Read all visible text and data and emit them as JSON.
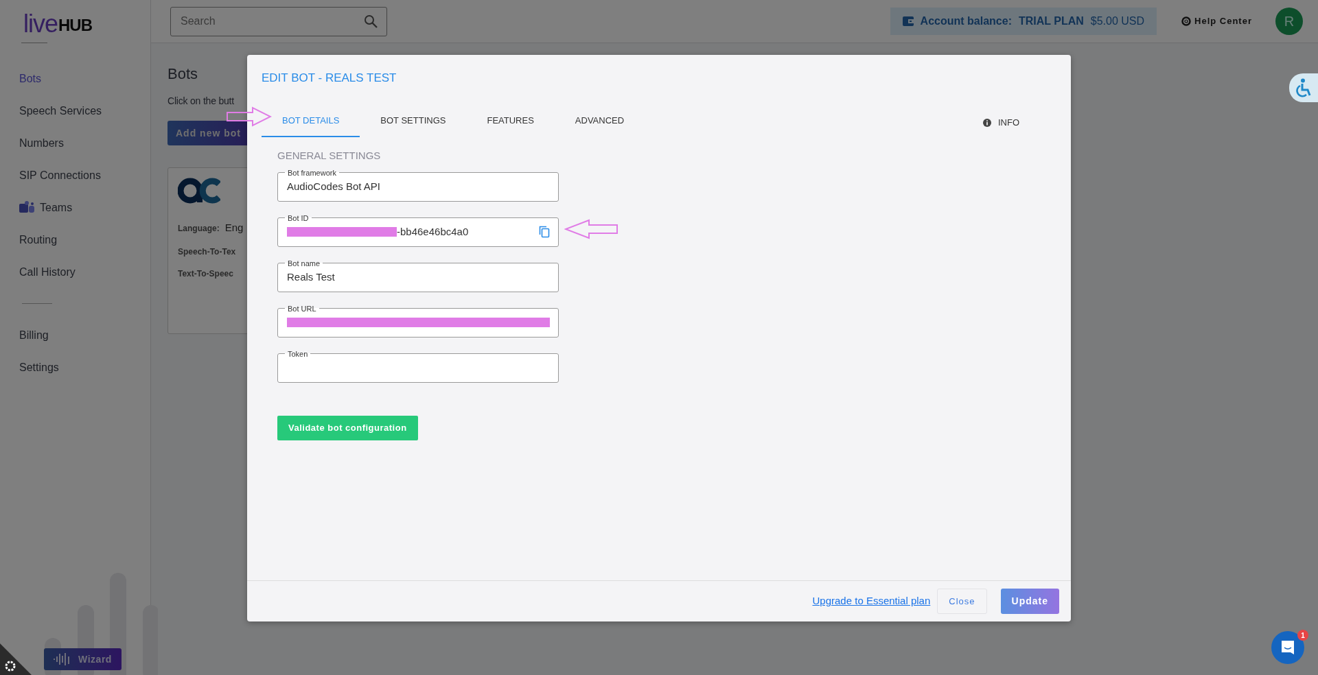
{
  "logo": {
    "part_1": "live",
    "part_2": "HUB"
  },
  "sidebar": {
    "groups": [
      {
        "items": [
          {
            "label": "Bots",
            "selected": true,
            "kind": "plain"
          },
          {
            "label": "Speech Services",
            "selected": false,
            "kind": "plain"
          },
          {
            "label": "Numbers",
            "selected": false,
            "kind": "plain"
          },
          {
            "label": "SIP Connections",
            "selected": false,
            "kind": "plain"
          },
          {
            "label": "Teams",
            "selected": false,
            "kind": "teams"
          },
          {
            "label": "Routing",
            "selected": false,
            "kind": "plain"
          },
          {
            "label": "Call History",
            "selected": false,
            "kind": "plain"
          }
        ]
      },
      {
        "items": [
          {
            "label": "Billing",
            "selected": false,
            "kind": "plain"
          },
          {
            "label": "Settings",
            "selected": false,
            "kind": "plain"
          }
        ]
      }
    ],
    "wizard_button": "Wizard"
  },
  "header": {
    "search": {
      "placeholder": "Search"
    },
    "account_balance": {
      "label": "Account balance:",
      "plan": "TRIAL PLAN",
      "amount": "$5.00 USD"
    },
    "help_center": "Help Center",
    "avatar": "R"
  },
  "page": {
    "title": "Bots",
    "intro": "Click on the butt",
    "add_button": "Add new bot",
    "bot_card": {
      "rows": [
        {
          "label": "Language:",
          "value": "Eng"
        },
        {
          "label": "Speech-To-Tex"
        },
        {
          "label": "Text-To-Speec"
        }
      ]
    }
  },
  "modal": {
    "title": "EDIT BOT - REALS TEST",
    "tabs": [
      {
        "label": "BOT DETAILS",
        "selected": true
      },
      {
        "label": "BOT SETTINGS",
        "selected": false
      },
      {
        "label": "FEATURES",
        "selected": false
      },
      {
        "label": "ADVANCED",
        "selected": false
      }
    ],
    "info": "INFO",
    "section": "GENERAL SETTINGS",
    "fields": [
      {
        "label": "Bot framework",
        "value": "AudioCodes Bot API",
        "redacted": false,
        "kind": "text"
      },
      {
        "label": "Bot ID",
        "value": "-bb46e46bc4a0",
        "redacted": true,
        "kind": "copyable"
      },
      {
        "label": "Bot name",
        "value": "Reals Test",
        "redacted": false,
        "kind": "text"
      },
      {
        "label": "Bot URL",
        "redacted": true,
        "kind": "text"
      },
      {
        "label": "Token",
        "redacted": false,
        "kind": "text"
      }
    ],
    "validate_button": "Validate bot configuration",
    "footer": {
      "upgrade_link": "Upgrade to Essential plan",
      "close_button": "Close",
      "update_button": {
        "label": "Update",
        "disabled": true
      }
    }
  },
  "chat": {
    "badge": "1"
  }
}
